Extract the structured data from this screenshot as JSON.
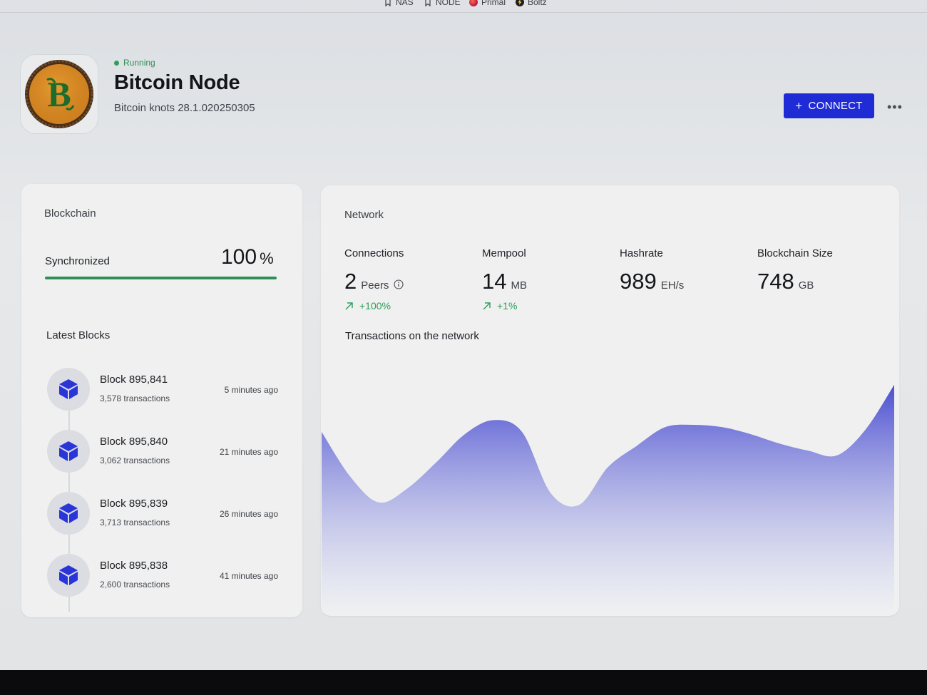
{
  "bookmarks": [
    {
      "label": "NAS",
      "icon": "bookmark-icon"
    },
    {
      "label": "NODE",
      "icon": "bookmark-icon"
    },
    {
      "label": "Primal",
      "icon": "primal-icon",
      "color": "#c0245e"
    },
    {
      "label": "Boltz",
      "icon": "boltz-icon",
      "color": "#1e1e1e"
    }
  ],
  "header": {
    "status": "Running",
    "title": "Bitcoin Node",
    "subtitle": "Bitcoin knots 28.1.020250305",
    "connect_label": "CONNECT",
    "more_label": "•••",
    "logo_letter": "B"
  },
  "blockchain": {
    "title": "Blockchain",
    "sync_label": "Synchronized",
    "sync_value": "100",
    "sync_unit": "%",
    "sync_progress": 1.0,
    "latest_title": "Latest Blocks",
    "blocks": [
      {
        "name": "Block 895,841",
        "transactions": "3,578 transactions",
        "time": "5 minutes ago"
      },
      {
        "name": "Block 895,840",
        "transactions": "3,062 transactions",
        "time": "21 minutes ago"
      },
      {
        "name": "Block 895,839",
        "transactions": "3,713 transactions",
        "time": "26 minutes ago"
      },
      {
        "name": "Block 895,838",
        "transactions": "2,600 transactions",
        "time": "41 minutes ago"
      }
    ]
  },
  "network": {
    "title": "Network",
    "connections": {
      "label": "Connections",
      "value": "2",
      "unit": "Peers",
      "change": "+100%"
    },
    "mempool": {
      "label": "Mempool",
      "value": "14",
      "unit": "MB",
      "change": "+1%"
    },
    "hashrate": {
      "label": "Hashrate",
      "value": "989",
      "unit": "EH/s"
    },
    "blockchain_size": {
      "label": "Blockchain Size",
      "value": "748",
      "unit": "GB"
    },
    "tx_chart_title": "Transactions on the network"
  },
  "colors": {
    "accent": "#1f2bd4",
    "success": "#2f9e5c",
    "chart_fill_top": "#4b4fd0",
    "chart_fill_bottom": "#eef0f7"
  },
  "chart_data": {
    "type": "area",
    "title": "Transactions on the network",
    "xlabel": "",
    "ylabel": "",
    "grid": false,
    "ylim": [
      0,
      100
    ],
    "x": [
      0,
      1,
      2,
      3,
      4,
      5,
      6,
      7,
      8,
      9,
      10,
      11,
      12,
      13,
      14,
      15,
      16,
      17,
      18,
      19,
      20
    ],
    "values": [
      77,
      58,
      47,
      53,
      64,
      76,
      82,
      77,
      51,
      46,
      62,
      71,
      79,
      80,
      79,
      76,
      72,
      69,
      67,
      78,
      97
    ]
  }
}
